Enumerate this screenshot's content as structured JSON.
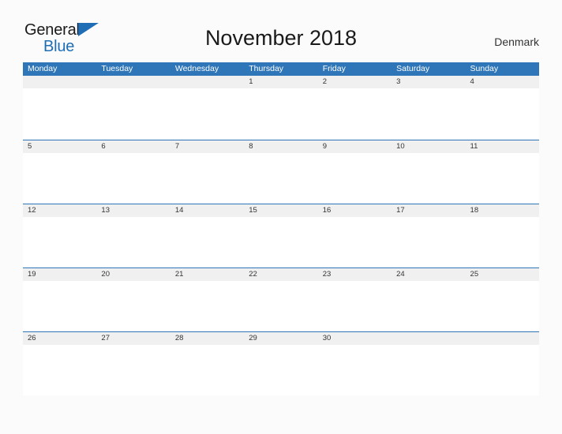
{
  "brand": {
    "name_part1": "General",
    "name_part2": "Blue",
    "flag_icon": "blue-triangle-flag"
  },
  "header": {
    "title": "November 2018",
    "region": "Denmark"
  },
  "calendar": {
    "weekdays": [
      "Monday",
      "Tuesday",
      "Wednesday",
      "Thursday",
      "Friday",
      "Saturday",
      "Sunday"
    ],
    "weeks": [
      [
        "",
        "",
        "",
        "1",
        "2",
        "3",
        "4"
      ],
      [
        "5",
        "6",
        "7",
        "8",
        "9",
        "10",
        "11"
      ],
      [
        "12",
        "13",
        "14",
        "15",
        "16",
        "17",
        "18"
      ],
      [
        "19",
        "20",
        "21",
        "22",
        "23",
        "24",
        "25"
      ],
      [
        "26",
        "27",
        "28",
        "29",
        "30",
        "",
        ""
      ]
    ]
  },
  "colors": {
    "header_blue": "#2e76b8",
    "band_gray": "#f0f0f0",
    "brand_blue": "#1f6db5",
    "page_background": "#fbfbfb"
  }
}
